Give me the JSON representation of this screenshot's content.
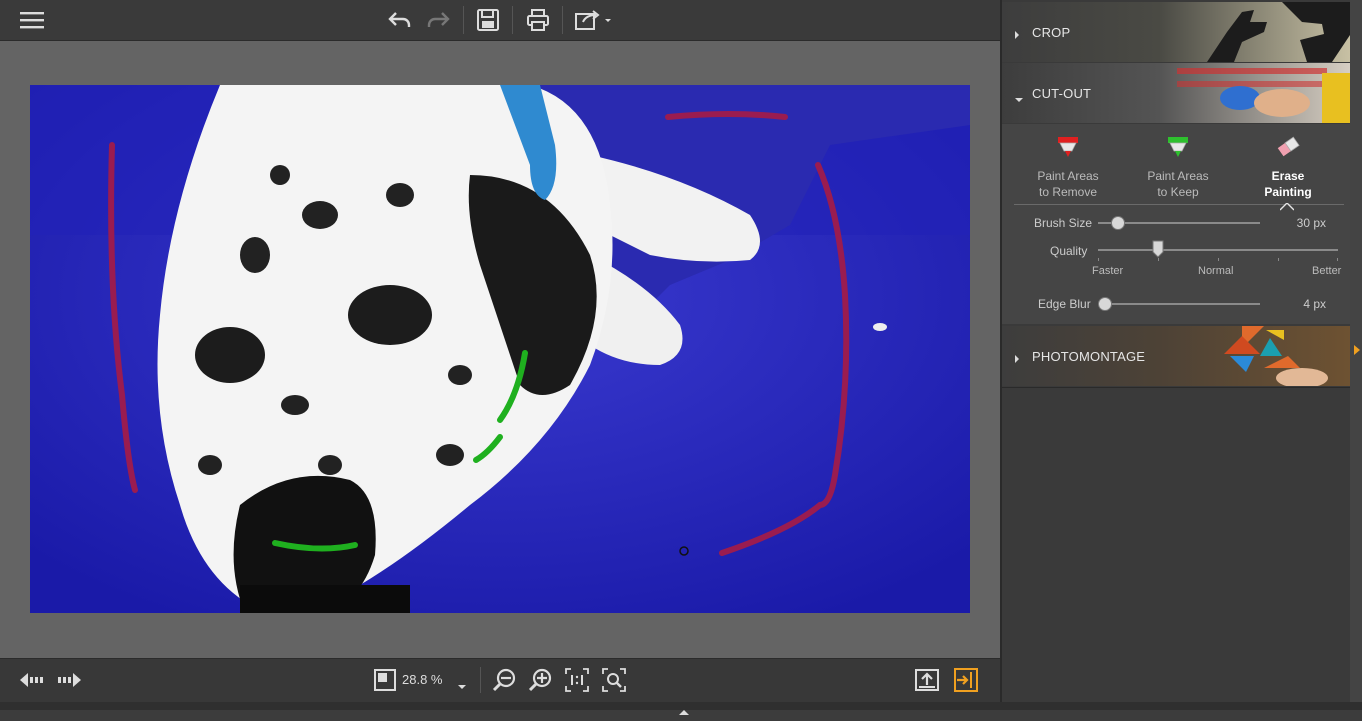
{
  "toolbar": {
    "menu_icon": "hamburger-menu-icon",
    "undo_icon": "undo-icon",
    "redo_icon": "redo-icon",
    "save_icon": "save-icon",
    "print_icon": "print-icon",
    "share_icon": "share-icon"
  },
  "panel": {
    "sections": {
      "crop": "CROP",
      "cutout": "CUT-OUT",
      "photomontage": "PHOTOMONTAGE"
    },
    "tools": [
      {
        "line1": "Paint Areas",
        "line2": "to Remove",
        "icon": "red-marker-icon",
        "color": "#e02020"
      },
      {
        "line1": "Paint Areas",
        "line2": "to Keep",
        "icon": "green-marker-icon",
        "color": "#2ec02e"
      },
      {
        "line1": "Erase",
        "line2": "Painting",
        "icon": "eraser-icon",
        "active": true
      }
    ],
    "brush_size": {
      "label": "Brush Size",
      "value": "30 px",
      "level": 0.1
    },
    "quality": {
      "label": "Quality",
      "faster": "Faster",
      "normal": "Normal",
      "better": "Better",
      "level": 0.25
    },
    "edge_blur": {
      "label": "Edge Blur",
      "value": "4 px",
      "level": 0.0
    }
  },
  "bottom": {
    "zoom": "28.8 %",
    "accent": "#f0a020"
  }
}
